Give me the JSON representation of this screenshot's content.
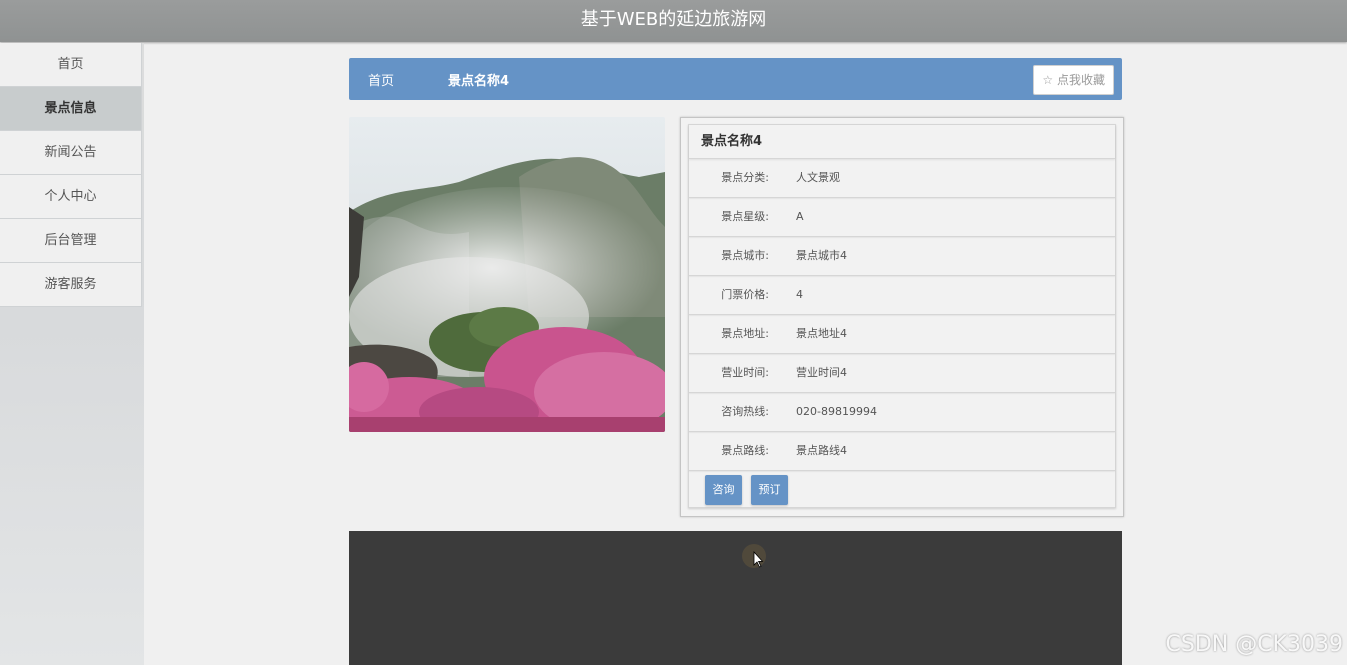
{
  "app": {
    "title": "基于WEB的延边旅游网"
  },
  "sidebar": {
    "items": [
      {
        "label": "首页"
      },
      {
        "label": "景点信息"
      },
      {
        "label": "新闻公告"
      },
      {
        "label": "个人中心"
      },
      {
        "label": "后台管理"
      },
      {
        "label": "游客服务"
      }
    ],
    "active_index": 1
  },
  "breadcrumb": {
    "home_label": "首页",
    "current_label": "景点名称4",
    "favorite_label": "☆ 点我收藏"
  },
  "attraction": {
    "name": "景点名称4",
    "fields": [
      {
        "label": "景点分类:",
        "value": "人文景观"
      },
      {
        "label": "景点星级:",
        "value": "A"
      },
      {
        "label": "景点城市:",
        "value": "景点城市4"
      },
      {
        "label": "门票价格:",
        "value": "4"
      },
      {
        "label": "景点地址:",
        "value": "景点地址4"
      },
      {
        "label": "营业时间:",
        "value": "营业时间4"
      },
      {
        "label": "咨询热线:",
        "value": "020-89819994"
      },
      {
        "label": "景点路线:",
        "value": "景点路线4"
      }
    ],
    "buttons": {
      "consult": "咨询",
      "book": "预订"
    }
  },
  "watermark": {
    "text": "CSDN @CK3039"
  },
  "colors": {
    "accent": "#6593c6",
    "topbar": "#959898",
    "footer": "#3b3b3b"
  }
}
